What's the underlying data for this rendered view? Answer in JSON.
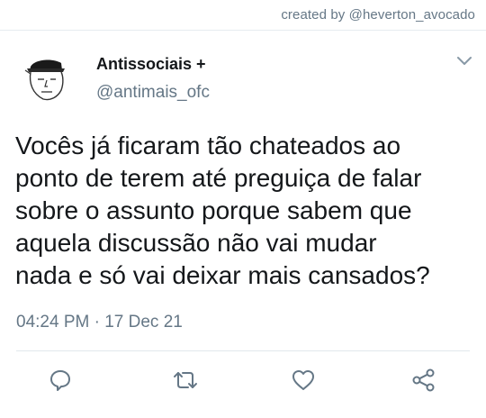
{
  "watermark": "created by @heverton_avocado",
  "tweet": {
    "display_name": "Antissociais +",
    "handle": "@antimais_ofc",
    "text_lines": [
      "Vocês já ficaram tão chateados ao",
      "ponto de terem até preguiça de falar",
      "sobre o assunto porque sabem que",
      "aquela discussão não vai mudar",
      "nada e só vai deixar mais cansados?"
    ],
    "timestamp": "04:24 PM · 17 Dec 21"
  },
  "actions": [
    {
      "name": "reply",
      "icon": "speech-bubble-icon"
    },
    {
      "name": "retweet",
      "icon": "retweet-arrows-icon"
    },
    {
      "name": "like",
      "icon": "heart-icon"
    },
    {
      "name": "share",
      "icon": "share-nodes-icon"
    }
  ],
  "colors": {
    "text": "#14171a",
    "secondary": "#657786",
    "divider": "#e1e8ed",
    "icon": "#657786"
  }
}
